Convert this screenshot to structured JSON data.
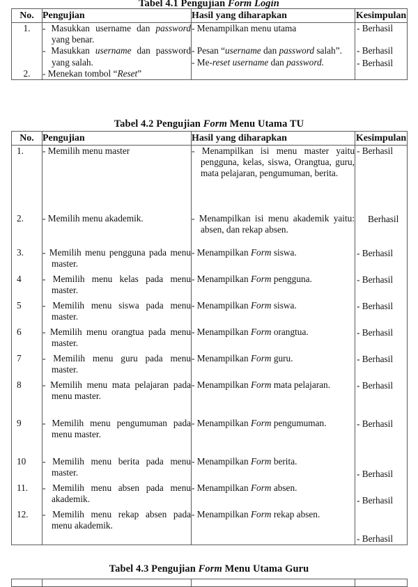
{
  "document": {
    "language": "Indonesian",
    "type": "thesis-testing-tables"
  },
  "table_41": {
    "caption_prefix": "Tabel 4.1 Pengujian ",
    "caption_italic": "Form Login",
    "caption_suffix": "",
    "columns": [
      "No.",
      "Pengujian",
      "Hasil yang diharapkan",
      "Kesimpulan"
    ],
    "rows": [
      {
        "no": "1.",
        "pengujian_lines": [
          "- Masukkan username dan password yang benar.",
          "- Masukkan username dan password yang salah."
        ],
        "hasil_lines": [
          "- Menampilkan menu utama",
          "- Pesan “username dan password salah”."
        ],
        "kesimpulan": [
          "- Berhasil",
          "- Berhasil"
        ]
      },
      {
        "no": "2.",
        "pengujian_lines": [
          "- Menekan tombol “Reset”"
        ],
        "hasil_lines": [
          "- Me-reset username dan password."
        ],
        "kesimpulan": [
          "- Berhasil"
        ]
      }
    ]
  },
  "table_42": {
    "caption_prefix": "Tabel 4.2 Pengujian ",
    "caption_italic": "Form",
    "caption_suffix": " Menu Utama TU",
    "columns": [
      "No.",
      "Pengujian",
      "Hasil yang diharapkan",
      "Kesimpulan"
    ],
    "rows": [
      {
        "no": "1.",
        "pengujian": "- Memilih menu master",
        "hasil": "- Menampilkan isi menu master yaitu pengguna, kelas, siswa, Orangtua, guru, mata pelajaran, pengumuman, berita.",
        "kesimpulan": "- Berhasil"
      },
      {
        "no": "2.",
        "pengujian": "- Memilih menu akademik.",
        "hasil": "- Menampilkan isi menu akademik yaitu: absen, dan rekap absen.",
        "kesimpulan": "Berhasil"
      },
      {
        "no": "3.",
        "pengujian": "- Memilih menu pengguna pada menu master.",
        "hasil": "- Menampilkan Form siswa.",
        "kesimpulan": "- Berhasil"
      },
      {
        "no": "4",
        "pengujian": "- Memilih menu kelas pada menu master.",
        "hasil": "- Menampilkan Form pengguna.",
        "kesimpulan": "- Berhasil"
      },
      {
        "no": "5",
        "pengujian": "- Memilih menu siswa pada menu master.",
        "hasil": "- Menampilkan Form siswa.",
        "kesimpulan": "- Berhasil"
      },
      {
        "no": "6",
        "pengujian": "- Memilih menu orangtua pada menu master.",
        "hasil": "- Menampilkan Form orangtua.",
        "kesimpulan": "- Berhasil"
      },
      {
        "no": "7",
        "pengujian": "- Memilih menu guru pada menu master.",
        "hasil": "- Menampilkan Form guru.",
        "kesimpulan": "- Berhasil"
      },
      {
        "no": "8",
        "pengujian": "- Memilih menu mata pelajaran pada menu master.",
        "hasil": "- Menampilkan Form mata pelajaran.",
        "kesimpulan": "- Berhasil"
      },
      {
        "no": "9",
        "pengujian": "- Memilih menu pengumuman pada menu master.",
        "hasil": "- Menampilkan Form pengumuman.",
        "kesimpulan": "- Berhasil"
      },
      {
        "no": "10",
        "pengujian": "- Memilih menu berita pada menu master.",
        "hasil": "- Menampilkan Form berita.",
        "kesimpulan": "- Berhasil"
      },
      {
        "no": "11.",
        "pengujian": "- Memilih menu absen pada menu akademik.",
        "hasil": "- Menampilkan Form absen.",
        "kesimpulan": "- Berhasil"
      },
      {
        "no": "12.",
        "pengujian": "- Memilih menu rekap absen pada menu akademik.",
        "hasil": "- Menampilkan Form rekap absen.",
        "kesimpulan": "- Berhasil"
      }
    ]
  },
  "table_43": {
    "caption_prefix": "Tabel 4.3 Pengujian ",
    "caption_italic": "Form",
    "caption_suffix": " Menu Utama Guru"
  }
}
